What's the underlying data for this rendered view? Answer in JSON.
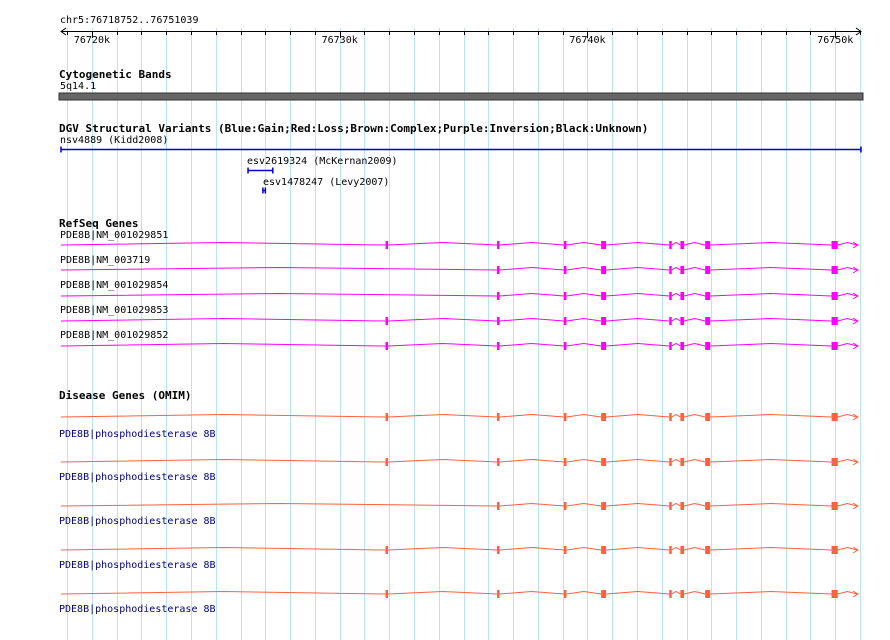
{
  "location": "chr5:76718752..76751039",
  "ruler": {
    "start": 76718752,
    "end": 76751039,
    "ticks": [
      {
        "pos": 76720000,
        "label": "76720k"
      },
      {
        "pos": 76730000,
        "label": "76730k"
      },
      {
        "pos": 76740000,
        "label": "76740k"
      },
      {
        "pos": 76750000,
        "label": "76750k"
      }
    ]
  },
  "colors": {
    "grid": "#b8e4f4",
    "cytoband": "#666666",
    "dgv": "#0000cc",
    "refseq": "#ff00ff",
    "omim": "#ff6040",
    "label_blue": "#000080"
  },
  "tracks": {
    "cytoband": {
      "title": "Cytogenetic Bands",
      "label": "5q14.1"
    },
    "dgv": {
      "title": "DGV Structural Variants (Blue:Gain;Red:Loss;Brown:Complex;Purple:Inversion;Black:Unknown)",
      "features": [
        {
          "label": "nsv4889 (Kidd2008)",
          "start": 76718752,
          "end": 76751039
        },
        {
          "label": "esv2619324 (McKernan2009)",
          "start": 76726300,
          "end": 76727300
        },
        {
          "label": "esv1478247 (Levy2007)",
          "start": 76726900,
          "end": 76727000
        }
      ]
    },
    "refseq": {
      "title": "RefSeq Genes",
      "genes": [
        {
          "label": "PDE8B|NM_001029851",
          "has_first_exon": true
        },
        {
          "label": "PDE8B|NM_003719",
          "has_first_exon": false
        },
        {
          "label": "PDE8B|NM_001029854",
          "has_first_exon": false
        },
        {
          "label": "PDE8B|NM_001029853",
          "has_first_exon": true
        },
        {
          "label": "PDE8B|NM_001029852",
          "has_first_exon": true
        }
      ]
    },
    "omim": {
      "title": "Disease Genes (OMIM)",
      "genes": [
        {
          "label": "PDE8B|phosphodiesterase 8B",
          "has_first_exon": true
        },
        {
          "label": "PDE8B|phosphodiesterase 8B",
          "has_first_exon": true
        },
        {
          "label": "PDE8B|phosphodiesterase 8B",
          "has_first_exon": false
        },
        {
          "label": "PDE8B|phosphodiesterase 8B",
          "has_first_exon": true
        },
        {
          "label": "PDE8B|phosphodiesterase 8B",
          "has_first_exon": true
        }
      ]
    }
  },
  "exons": [
    {
      "start": 76731850,
      "end": 76731950,
      "first": true
    },
    {
      "start": 76736350,
      "end": 76736450
    },
    {
      "start": 76739050,
      "end": 76739150
    },
    {
      "start": 76740550,
      "end": 76740750
    },
    {
      "start": 76743300,
      "end": 76743400
    },
    {
      "start": 76743750,
      "end": 76743900
    },
    {
      "start": 76744750,
      "end": 76744950
    },
    {
      "start": 76749850,
      "end": 76750100
    }
  ]
}
